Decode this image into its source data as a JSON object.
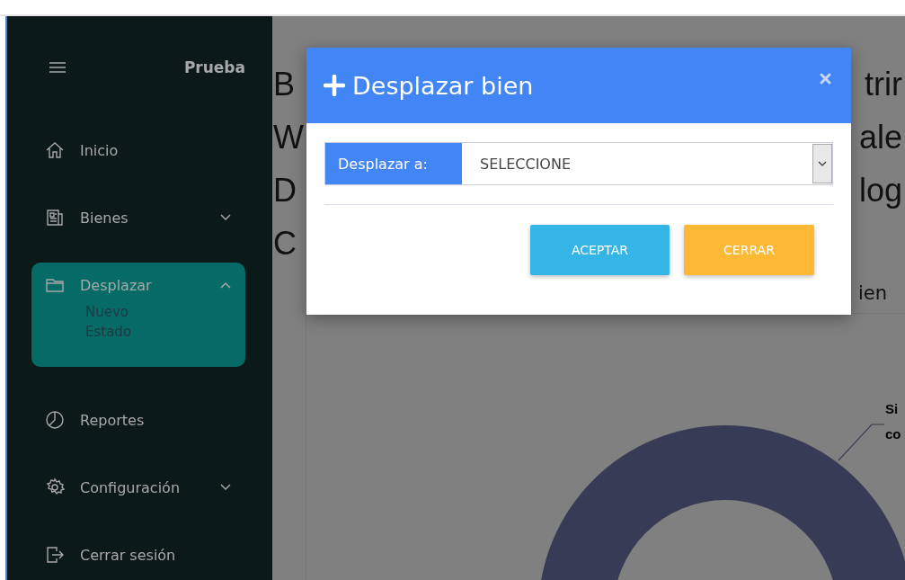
{
  "sidebar": {
    "brand": "Prueba",
    "items": [
      {
        "label": "Inicio",
        "selected": false
      },
      {
        "label": "Bienes",
        "selected": false,
        "expanded": false
      },
      {
        "label": "Desplazar",
        "selected": true,
        "expanded": true,
        "children": [
          {
            "label": "Nuevo"
          },
          {
            "label": "Estado"
          }
        ]
      },
      {
        "label": "Reportes",
        "selected": false
      },
      {
        "label": "Configuración",
        "selected": false,
        "expanded": false
      },
      {
        "label": "Cerrar sesión",
        "selected": false
      }
    ]
  },
  "background": {
    "heading_lines": [
      {
        "left": "B",
        "right": "trir"
      },
      {
        "left": "W",
        "right": "ale"
      },
      {
        "left": "D",
        "right": "log"
      },
      {
        "left": "C"
      }
    ],
    "tab_fragment": "ien",
    "chart_labels": [
      "Si",
      "co"
    ]
  },
  "modal": {
    "title": "Desplazar bien",
    "field_label": "Desplazar a:",
    "select_value": "SELECCIONE",
    "buttons": [
      {
        "label": "ACEPTAR",
        "kind": "primary"
      },
      {
        "label": "CERRAR",
        "kind": "warning"
      }
    ]
  }
}
